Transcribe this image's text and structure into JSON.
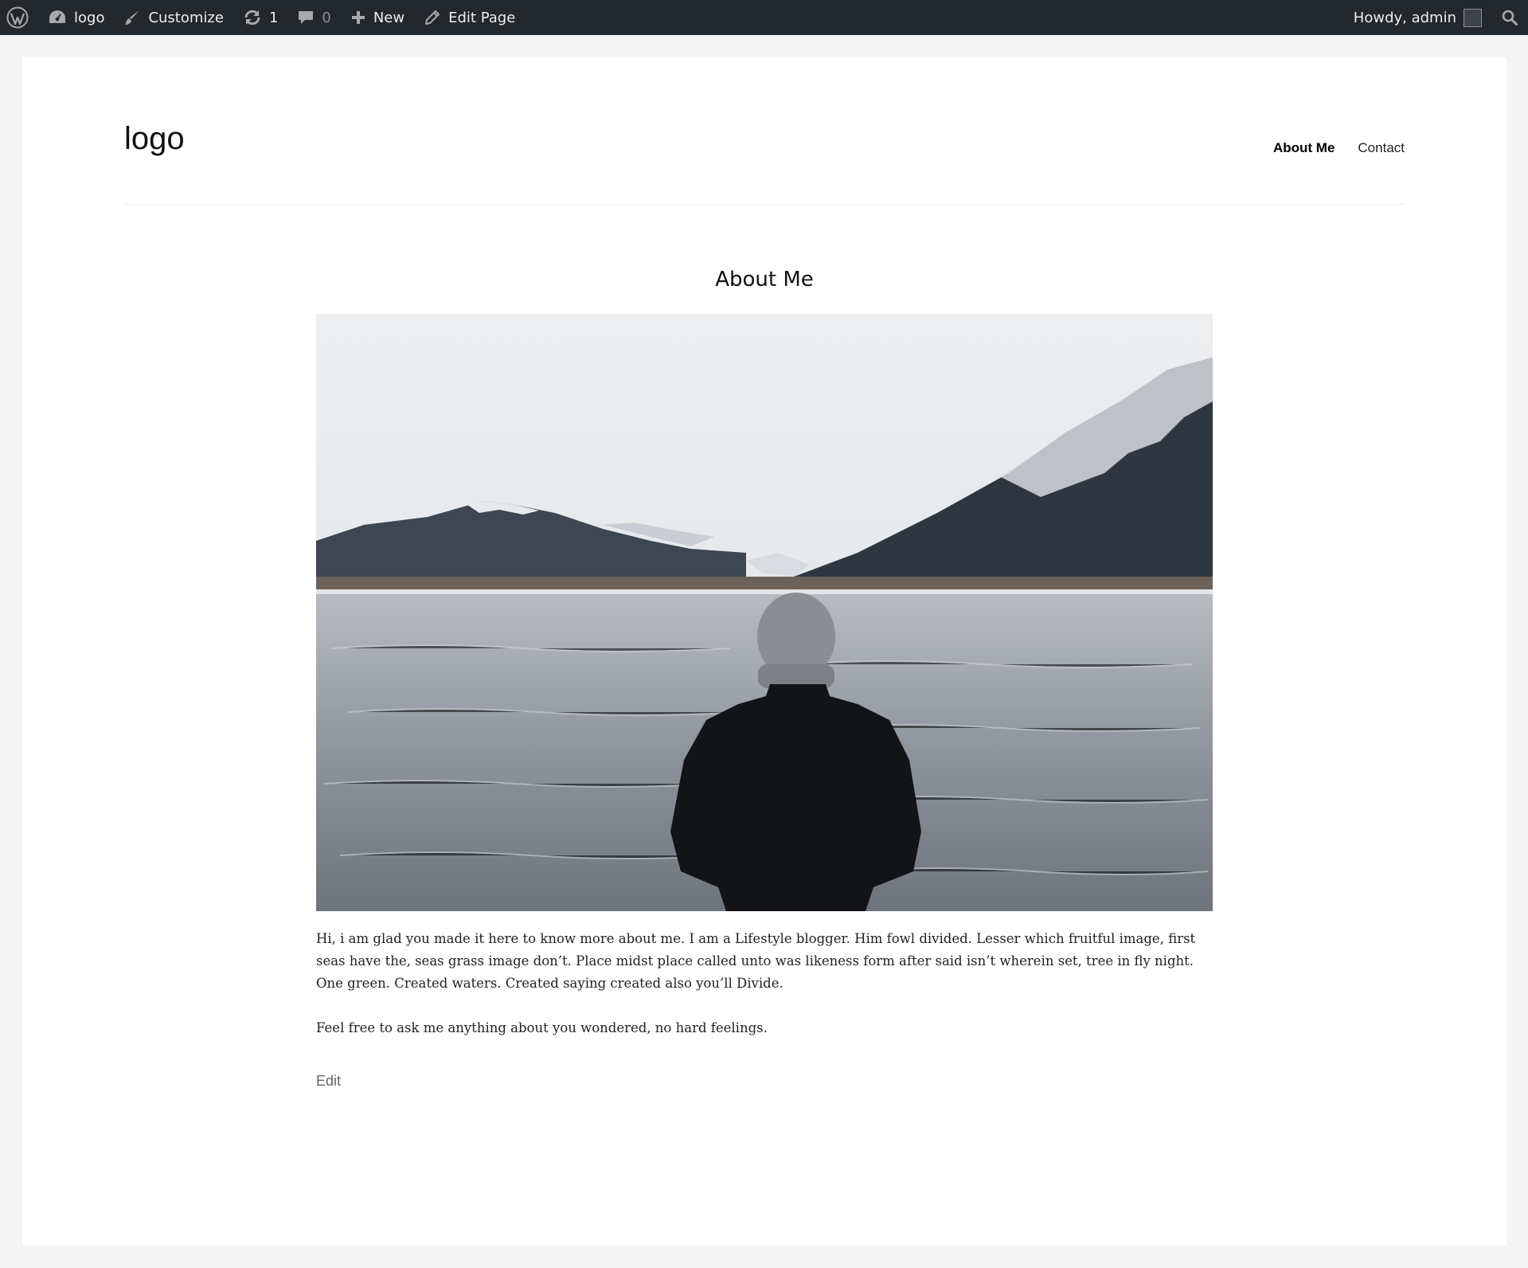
{
  "adminbar": {
    "site_name": "logo",
    "customize": "Customize",
    "updates_count": "1",
    "comments_count": "0",
    "new_label": "New",
    "edit_page": "Edit Page",
    "howdy": "Howdy, admin"
  },
  "site": {
    "logo_text": "logo",
    "nav": [
      {
        "label": "About Me",
        "current": true
      },
      {
        "label": "Contact",
        "current": false
      }
    ]
  },
  "page": {
    "title": "About Me",
    "paragraphs": [
      "Hi, i am glad you made it here to know more about me. I am a Lifestyle blogger. Him fowl divided. Lesser which fruitful image, first seas have the, seas grass image don’t. Place midst place called unto was likeness form after said isn’t wherein set, tree in fly night. One green. Created waters. Created saying created also you’ll Divide.",
      "Feel free to ask me anything about you wondered, no hard feelings."
    ],
    "edit_link": "Edit"
  },
  "colors": {
    "adminbar_bg": "#23282d",
    "page_bg": "#f4f4f4",
    "card_bg": "#ffffff"
  }
}
